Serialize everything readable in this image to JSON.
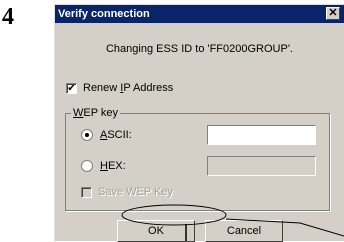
{
  "step_number": "4",
  "dialog": {
    "title": "Verify connection",
    "close_icon": "close-icon",
    "message": "Changing ESS ID to 'FF0200GROUP'.",
    "renew_ip": {
      "pre": "Renew ",
      "accel": "I",
      "post": "P Address",
      "checked": true
    },
    "wep_group": {
      "accel": "W",
      "rest": "EP key"
    },
    "ascii": {
      "accel": "A",
      "rest": "SCII:",
      "selected": true,
      "value": ""
    },
    "hex": {
      "accel": "H",
      "rest": "EX:",
      "selected": false,
      "value": ""
    },
    "save_wep": {
      "label": "Save WEP Key",
      "checked": false,
      "disabled": true
    },
    "ok_label": "OK",
    "cancel_label": "Cancel"
  }
}
